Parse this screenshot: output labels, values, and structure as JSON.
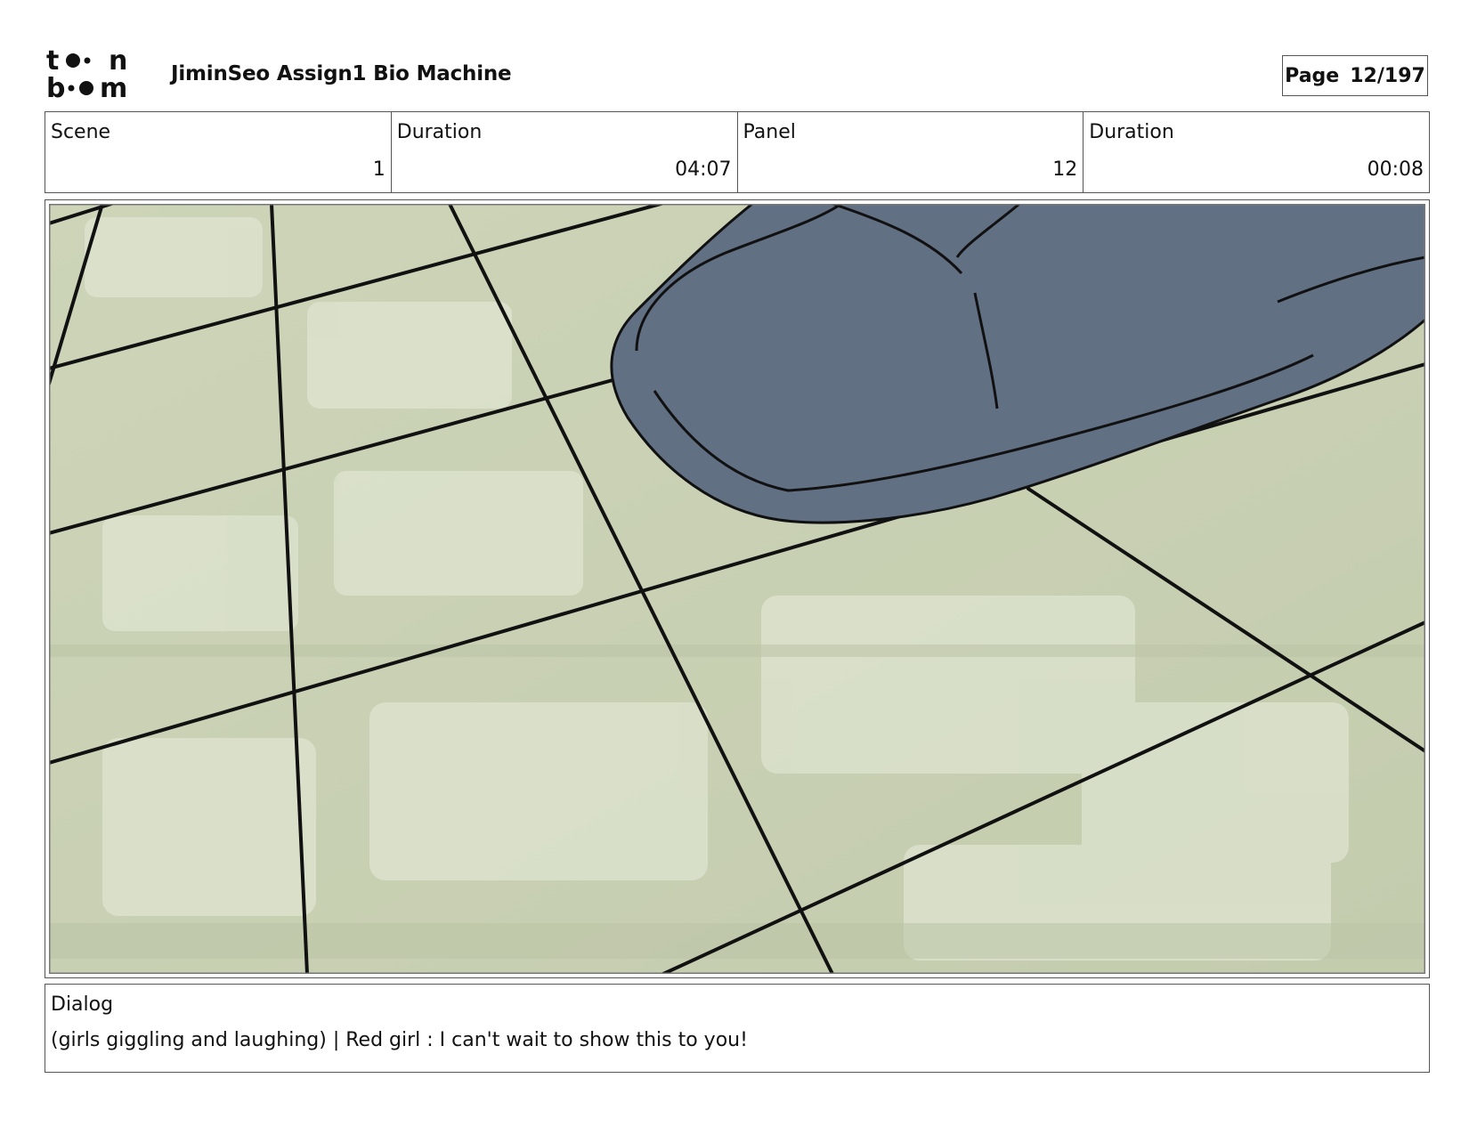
{
  "header": {
    "logo_text": [
      "to",
      "on",
      "bo",
      "om"
    ],
    "title": "JiminSeo Assign1 Bio Machine",
    "page_label": "Page",
    "page_value": "12/197"
  },
  "info": {
    "scene_label": "Scene",
    "scene_value": "1",
    "scene_duration_label": "Duration",
    "scene_duration_value": "04:07",
    "panel_label": "Panel",
    "panel_value": "12",
    "panel_duration_label": "Duration",
    "panel_duration_value": "00:08"
  },
  "panel": {
    "drawing": "storyboard-panel-floor-and-shoe",
    "colors": {
      "floor": "#c9d1b4",
      "tile_light": "#dde3cf",
      "shoe": "#627084",
      "line": "#111111"
    }
  },
  "dialog": {
    "label": "Dialog",
    "text": "(girls giggling and laughing) | Red girl : I can't wait to show this to you!"
  }
}
